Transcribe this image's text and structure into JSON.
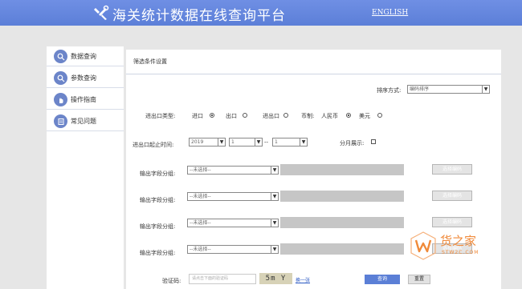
{
  "header": {
    "title": "海关统计数据在线查询平台",
    "english_link": "ENGLISH"
  },
  "sidebar": {
    "items": [
      {
        "label": "数据查询",
        "icon": "search-icon"
      },
      {
        "label": "参数查询",
        "icon": "search-icon"
      },
      {
        "label": "操作指南",
        "icon": "hand-icon"
      },
      {
        "label": "常见问题",
        "icon": "document-icon"
      }
    ]
  },
  "main": {
    "panel_title": "筛选条件设置",
    "sort_label": "排序方式:",
    "sort_value": "编码排序",
    "trade_type_label": "进出口类型:",
    "trade_options": [
      {
        "label": "进口",
        "selected": true
      },
      {
        "label": "出口",
        "selected": false
      },
      {
        "label": "进出口",
        "selected": false
      }
    ],
    "currency_label": "币制:",
    "currency_options": [
      {
        "label": "人民币",
        "selected": true
      },
      {
        "label": "美元",
        "selected": false
      }
    ],
    "period_label": "进出口起止时间:",
    "year_value": "2019",
    "month_start_value": "1",
    "range_separator": "--",
    "month_end_value": "1",
    "monthly_label": "分月展示:",
    "output_groups": [
      {
        "label": "输出字段分组:",
        "select_value": "--未选择--",
        "button_label": "选择编码"
      },
      {
        "label": "输出字段分组:",
        "select_value": "--未选择--",
        "button_label": "选择编码"
      },
      {
        "label": "输出字段分组:",
        "select_value": "--未选择--",
        "button_label": "选择编码"
      },
      {
        "label": "输出字段分组:",
        "select_value": "--未选择--",
        "button_label": "选择编码"
      }
    ],
    "captcha_label": "验证码:",
    "captcha_placeholder": "请点击下面的验证码",
    "captcha_text": "5m Y",
    "refresh_link": "换一张",
    "query_button": "查询",
    "reset_button": "重置"
  },
  "watermark": {
    "text": "货之家",
    "sub": "STW2C.COM"
  },
  "colors": {
    "header_blue": "#6f8fe4",
    "icon_blue": "#6c85c9",
    "button_blue": "#5b7fd6",
    "watermark_orange": "#f08a3a"
  }
}
